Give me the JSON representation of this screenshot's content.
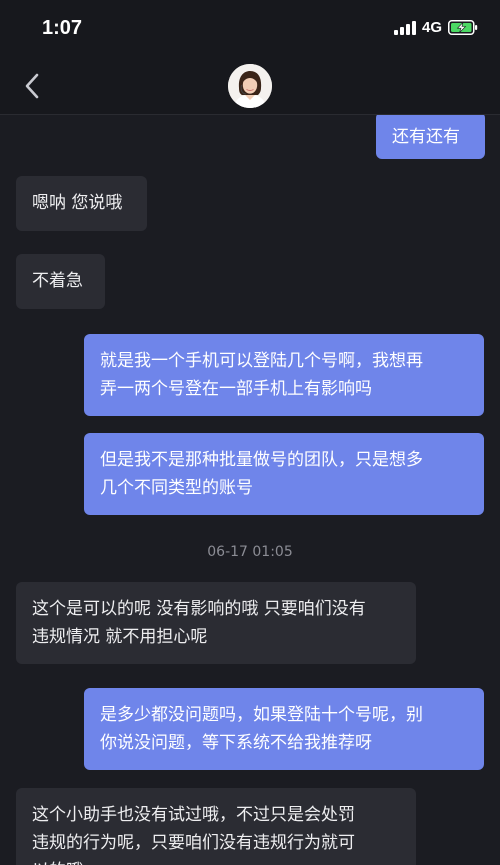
{
  "status_bar": {
    "time": "1:07",
    "network": "4G",
    "battery_state": "charging",
    "battery_color": "#4cd964"
  },
  "nav": {
    "back_icon": "chevron-left-icon",
    "avatar": "agent-avatar"
  },
  "colors": {
    "background": "#1b1c22",
    "incoming_bubble": "#2b2c33",
    "outgoing_bubble": "#6f85ea"
  },
  "messages": [
    {
      "side": "out",
      "text": "还有还有"
    },
    {
      "side": "in",
      "text": "嗯呐 您说哦"
    },
    {
      "side": "in",
      "text": "不着急"
    },
    {
      "side": "out",
      "text": "就是我一个手机可以登陆几个号啊，我想再\n弄一两个号登在一部手机上有影响吗"
    },
    {
      "side": "out",
      "text": "但是我不是那种批量做号的团队，只是想多\n几个不同类型的账号"
    },
    {
      "side": "time",
      "text": "06-17 01:05"
    },
    {
      "side": "in",
      "text": "这个是可以的呢 没有影响的哦 只要咱们没有\n违规情况 就不用担心呢"
    },
    {
      "side": "out",
      "text": "是多少都没问题吗，如果登陆十个号呢，别\n你说没问题，等下系统不给我推荐呀"
    },
    {
      "side": "in",
      "text": "这个小助手也没有试过哦，不过只是会处罚\n违规的行为呢，只要咱们没有违规行为就可\n以的哦"
    }
  ]
}
